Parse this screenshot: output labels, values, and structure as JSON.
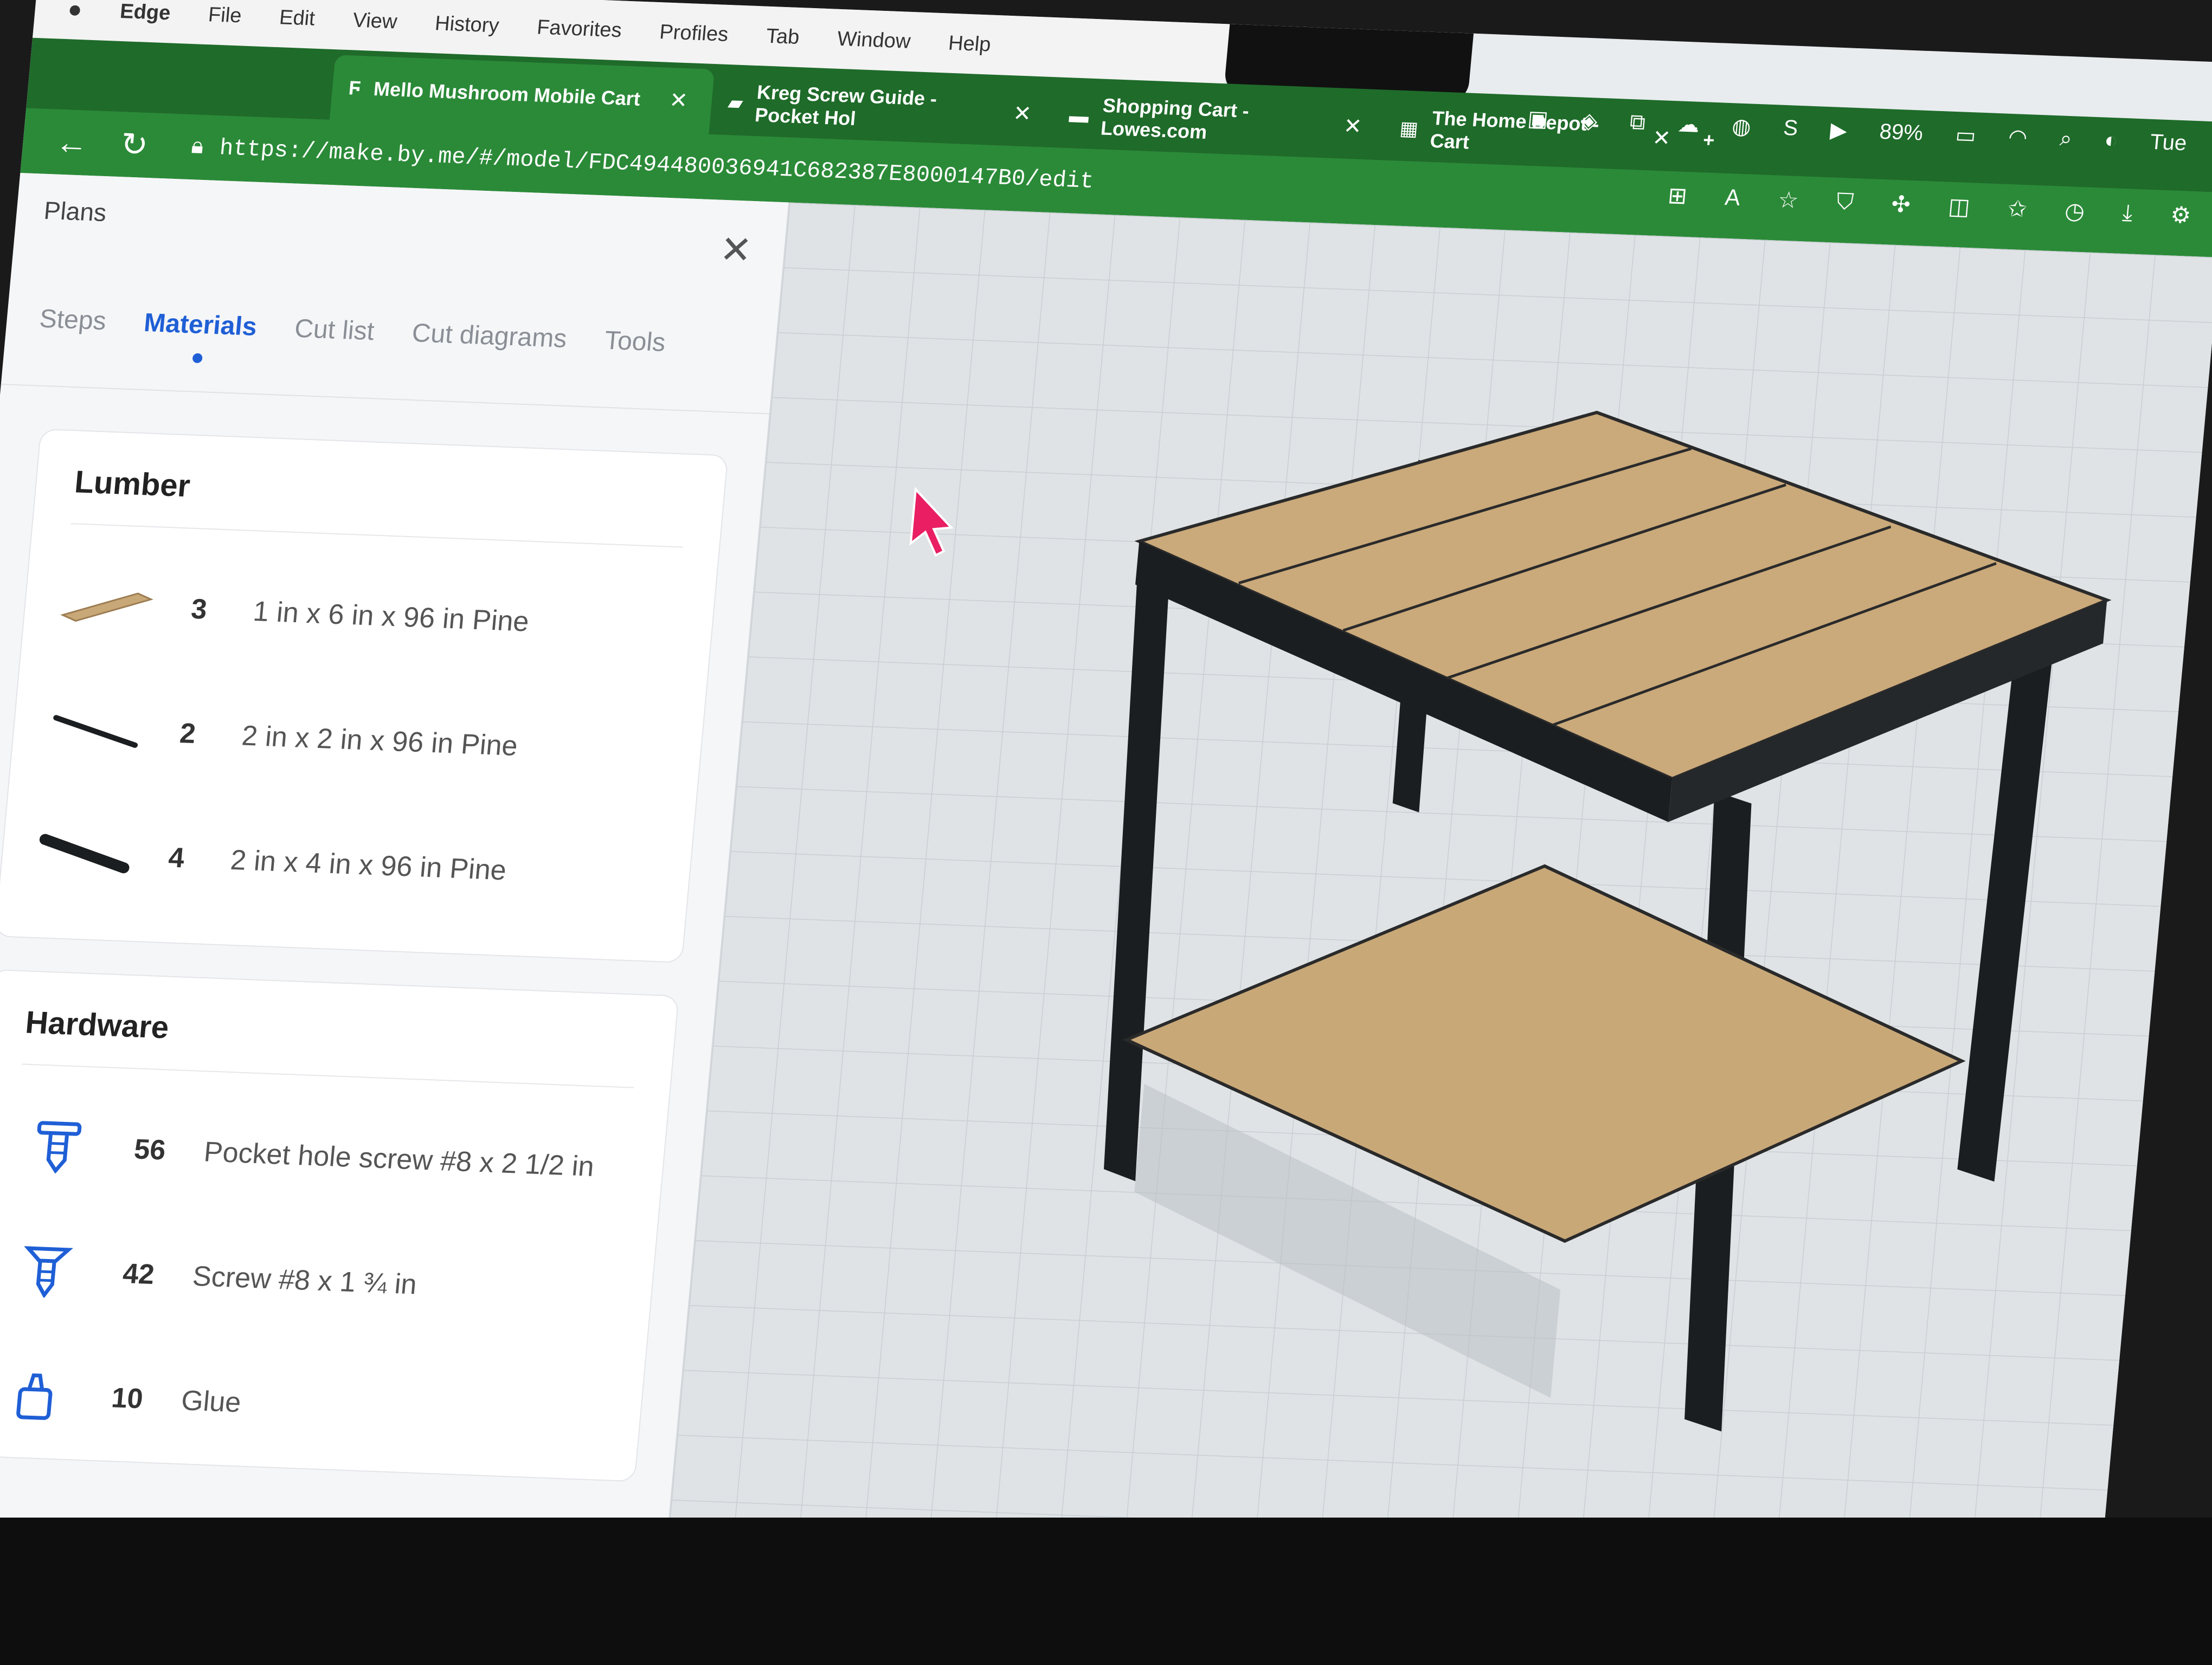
{
  "menubar": {
    "app": "Edge",
    "items": [
      "File",
      "Edit",
      "View",
      "History",
      "Favorites",
      "Profiles",
      "Tab",
      "Window",
      "Help"
    ]
  },
  "status": {
    "battery": "89%",
    "day": "Tue"
  },
  "tabs": [
    {
      "title": "Mello Mushroom Mobile Cart",
      "active": true
    },
    {
      "title": "Kreg Screw Guide - Pocket Hol",
      "active": false
    },
    {
      "title": "Shopping Cart - Lowes.com",
      "active": false
    },
    {
      "title": "The Home Depot - Cart",
      "active": false
    }
  ],
  "address": {
    "url": "https://make.by.me/#/model/FDC494480036941C682387E8000147B0/edit"
  },
  "panel": {
    "title": "Plans",
    "subtabs": [
      "Steps",
      "Materials",
      "Cut list",
      "Cut diagrams",
      "Tools"
    ],
    "selected_subtab": "Materials",
    "lumber": {
      "heading": "Lumber",
      "items": [
        {
          "qty": "3",
          "desc": "1 in x 6 in x 96 in Pine",
          "icon": "board-icon"
        },
        {
          "qty": "2",
          "desc": "2 in x 2 in x 96 in Pine",
          "icon": "stick-icon"
        },
        {
          "qty": "4",
          "desc": "2 in x 4 in x 96 in Pine",
          "icon": "stud-icon"
        }
      ]
    },
    "hardware": {
      "heading": "Hardware",
      "items": [
        {
          "qty": "56",
          "desc": "Pocket hole screw #8 x 2 1/2 in",
          "icon": "pocket-screw-icon"
        },
        {
          "qty": "42",
          "desc": "Screw #8 x 1 ¾ in",
          "icon": "screw-icon"
        },
        {
          "qty": "10",
          "desc": "Glue",
          "icon": "glue-bottle-icon"
        }
      ]
    }
  },
  "colors": {
    "browser_green": "#2b8a38",
    "tab_dark": "#1f6b2a",
    "accent_blue": "#1f5fd6",
    "wood": "#c9a878",
    "frame": "#1b1e20"
  }
}
